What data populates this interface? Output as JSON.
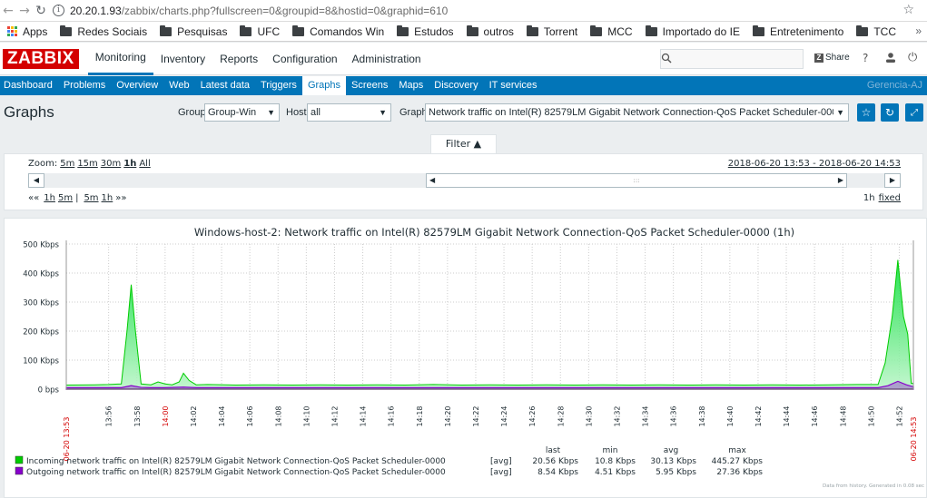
{
  "browser": {
    "url_host": "20.20.1.93",
    "url_path": "/zabbix/charts.php?fullscreen=0&groupid=8&hostid=0&graphid=610",
    "bookmarks": [
      {
        "label": "Apps",
        "type": "apps"
      },
      {
        "label": "Redes Sociais",
        "type": "folder"
      },
      {
        "label": "Pesquisas",
        "type": "folder"
      },
      {
        "label": "UFC",
        "type": "folder"
      },
      {
        "label": "Comandos Win",
        "type": "folder"
      },
      {
        "label": "Estudos",
        "type": "folder"
      },
      {
        "label": "outros",
        "type": "folder"
      },
      {
        "label": "Torrent",
        "type": "folder"
      },
      {
        "label": "MCC",
        "type": "folder"
      },
      {
        "label": "Importado do IE",
        "type": "folder"
      },
      {
        "label": "Entretenimento",
        "type": "folder"
      },
      {
        "label": "TCC",
        "type": "folder"
      }
    ],
    "more": "»"
  },
  "header": {
    "logo": "ZABBIX",
    "menu": [
      "Monitoring",
      "Inventory",
      "Reports",
      "Configuration",
      "Administration"
    ],
    "share": "Share",
    "help": "?"
  },
  "submenu": {
    "items": [
      "Dashboard",
      "Problems",
      "Overview",
      "Web",
      "Latest data",
      "Triggers",
      "Graphs",
      "Screens",
      "Maps",
      "Discovery",
      "IT services"
    ],
    "selected": "Graphs",
    "server_name": "Gerencia-AJ"
  },
  "page": {
    "title": "Graphs",
    "group_label": "Group",
    "group_value": "Group-Win",
    "host_label": "Host",
    "host_value": "all",
    "graph_label": "Graph",
    "graph_value": "Network traffic on Intel(R) 82579LM Gigabit Network Connection-QoS Packet Scheduler-0000"
  },
  "filter": {
    "tab_label": "Filter ▲",
    "zoom_label": "Zoom:",
    "zoom_options": [
      "5m",
      "15m",
      "30m",
      "1h",
      "All"
    ],
    "zoom_selected": "1h",
    "period": "2018-06-20 13:53 - 2018-06-20 14:53",
    "nav_back": [
      "««",
      "1h",
      "5m"
    ],
    "nav_sep": "|",
    "nav_fwd": [
      "5m",
      "1h",
      "»»"
    ],
    "duration": "1h",
    "fixed": "fixed"
  },
  "chart_data": {
    "type": "area",
    "title": "Windows-host-2: Network traffic on Intel(R) 82579LM Gigabit Network Connection-QoS Packet Scheduler-0000 (1h)",
    "yunit": "Kbps",
    "ylim": [
      0,
      500
    ],
    "yticks": [
      "0 bps",
      "100 Kbps",
      "200 Kbps",
      "300 Kbps",
      "400 Kbps",
      "500 Kbps"
    ],
    "x_start_label": "06-20 13:53",
    "x_end_label": "06-20 14:53",
    "x_tick_labels": [
      "13:56",
      "13:58",
      "14:00",
      "14:02",
      "14:04",
      "14:06",
      "14:08",
      "14:10",
      "14:12",
      "14:14",
      "14:16",
      "14:18",
      "14:20",
      "14:22",
      "14:24",
      "14:26",
      "14:28",
      "14:30",
      "14:32",
      "14:34",
      "14:36",
      "14:38",
      "14:40",
      "14:42",
      "14:44",
      "14:46",
      "14:48",
      "14:50",
      "14:52"
    ],
    "x_highlight": [
      "14:00"
    ],
    "series": [
      {
        "name": "Incoming network traffic on Intel(R) 82579LM Gigabit Network Connection-QoS Packet Scheduler-0000",
        "color": "#00cc00",
        "agg": "[avg]",
        "last": "20.56 Kbps",
        "min": "10.8 Kbps",
        "avg": "30.13 Kbps",
        "max": "445.27 Kbps",
        "points": [
          [
            0,
            14
          ],
          [
            2,
            15
          ],
          [
            3,
            16
          ],
          [
            3.9,
            18
          ],
          [
            4.3,
            200
          ],
          [
            4.6,
            360
          ],
          [
            4.9,
            200
          ],
          [
            5.3,
            18
          ],
          [
            6,
            15
          ],
          [
            6.5,
            25
          ],
          [
            7,
            18
          ],
          [
            7.5,
            15
          ],
          [
            8,
            25
          ],
          [
            8.3,
            55
          ],
          [
            8.7,
            30
          ],
          [
            9.2,
            15
          ],
          [
            10,
            16
          ],
          [
            12,
            14
          ],
          [
            14,
            15
          ],
          [
            16,
            14
          ],
          [
            18,
            15
          ],
          [
            20,
            14
          ],
          [
            22,
            15
          ],
          [
            24,
            14
          ],
          [
            26,
            16
          ],
          [
            28,
            14
          ],
          [
            30,
            15
          ],
          [
            32,
            14
          ],
          [
            34,
            15
          ],
          [
            36,
            14
          ],
          [
            38,
            15
          ],
          [
            40,
            14
          ],
          [
            42,
            15
          ],
          [
            44,
            14
          ],
          [
            46,
            15
          ],
          [
            48,
            14
          ],
          [
            50,
            15
          ],
          [
            52,
            14
          ],
          [
            54,
            15
          ],
          [
            56,
            16
          ],
          [
            57.5,
            16
          ],
          [
            58,
            90
          ],
          [
            58.5,
            250
          ],
          [
            58.9,
            445
          ],
          [
            59.3,
            250
          ],
          [
            59.6,
            190
          ],
          [
            59.85,
            20
          ],
          [
            60,
            20
          ]
        ]
      },
      {
        "name": "Outgoing network traffic on Intel(R) 82579LM Gigabit Network Connection-QoS Packet Scheduler-0000",
        "color": "#8800cc",
        "agg": "[avg]",
        "last": "8.54 Kbps",
        "min": "4.51 Kbps",
        "avg": "5.95 Kbps",
        "max": "27.36 Kbps",
        "points": [
          [
            0,
            5
          ],
          [
            3.9,
            5
          ],
          [
            4.6,
            12
          ],
          [
            5.3,
            6
          ],
          [
            6,
            5
          ],
          [
            7,
            5
          ],
          [
            8.3,
            7
          ],
          [
            9.2,
            5
          ],
          [
            20,
            5
          ],
          [
            40,
            5
          ],
          [
            57.5,
            5
          ],
          [
            58.2,
            12
          ],
          [
            58.9,
            27
          ],
          [
            59.5,
            15
          ],
          [
            60,
            8
          ]
        ]
      }
    ],
    "legend_headers": [
      "last",
      "min",
      "avg",
      "max"
    ],
    "footer_note": "Data from history. Generated in 0.08 sec"
  },
  "colors": {
    "accent": "#0275b8",
    "logo": "#d40000"
  }
}
